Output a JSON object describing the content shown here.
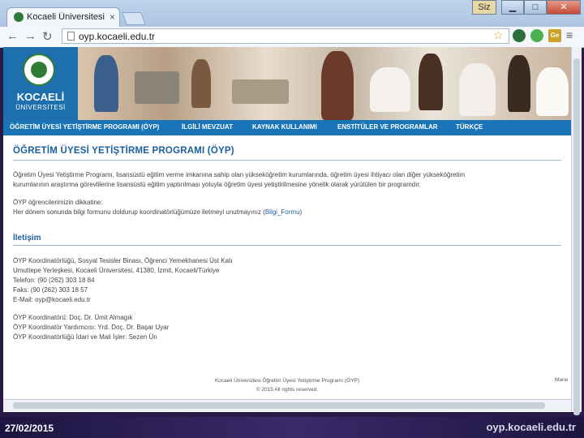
{
  "browser": {
    "tab_title": "Kocaeli Üniversitesi Ö",
    "tab_close": "×",
    "address": "oyp.kocaeli.edu.tr",
    "user_badge": "Siz"
  },
  "site": {
    "logo_name": "KOCAELİ",
    "logo_sub": "ÜNİVERSİTESİ",
    "menu": [
      "ÖĞRETİM ÜYESİ YETİŞTİRME PROGRAMI (ÖYP)",
      "İLGİLİ MEVZUAT",
      "KAYNAK KULLANIMI",
      "ENSTİTÜLER VE PROGRAMLAR",
      "TÜRKÇE"
    ],
    "page_title": "ÖĞRETİM ÜYESİ YETİŞTİRME PROGRAMI (ÖYP)",
    "intro": [
      "Öğretim Üyesi Yetiştirme Programı, lisansüstü eğitim verme imkanına sahip olan yükseköğretim kurumlarında, öğretim üyesi ihtiyacı olan diğer yükseköğretim",
      "kurumlarının araştırma görevlilerine lisansüstü eğitim yaptırılması yoluyla öğretim üyesi yetiştirilmesine yönelik olarak yürütülen bir programdır."
    ],
    "notice": [
      "ÖYP öğrencilerimizin dikkatine:",
      "Her dönem sonunda bilgi formunu doldurup koordinatörlüğümüze iletmeyi unutmayınız ("
    ],
    "notice_link": "Bilgi_Formu",
    "notice_end": ")",
    "contact_heading": "İletişim",
    "contact": [
      "ÖYP Koordinatörlüğü, Sosyal Tesisler Binası, Öğrenci Yemekhanesi Üst Katı",
      "Umuttepe Yerleşkesi, Kocaeli Üniversitesi, 41380, İzmit, Kocaeli/Türkiye",
      "Telefon: (90 (262) 303 18 84",
      "Faks: (90 (262) 303 18 57",
      "E-Mail: oyp@kocaeli.edu.tr"
    ],
    "staff": [
      "ÖYP Koordinatörü: Doç. Dr. Ümit Almagık",
      "ÖYP Koordinatör Yardımcısı: Yrd. Doç. Dr. Başar Uyar",
      "ÖYP Koordinatörlüğü İdari ve Mali İşler: Sezen Ün"
    ],
    "footer_line1": "Kocaeli Üniversitesi Öğretim Üyesi Yetiştirme Programı (ÖYP)",
    "footer_line2": "© 2015 All rights reserved.",
    "footer_right": "Mane"
  },
  "slide": {
    "date": "27/02/2015",
    "url": "oyp.kocaeli.edu.tr"
  },
  "icons": [
    "back-icon",
    "forward-icon",
    "reload-icon",
    "star-icon",
    "extension-icon",
    "chrome-icon",
    "translate-icon",
    "menu-icon"
  ]
}
